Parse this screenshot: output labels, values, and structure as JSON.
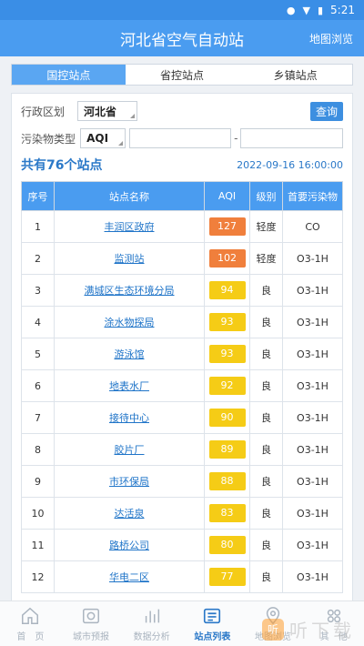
{
  "status_bar": {
    "time": "5:21"
  },
  "app_bar": {
    "title": "河北省空气自动站",
    "map_link": "地图浏览"
  },
  "tabs": [
    {
      "label": "国控站点",
      "active": true
    },
    {
      "label": "省控站点",
      "active": false
    },
    {
      "label": "乡镇站点",
      "active": false
    }
  ],
  "filters": {
    "region_label": "行政区划",
    "region_value": "河北省",
    "pollutant_label": "污染物类型",
    "pollutant_value": "AQI",
    "range_separator": "-",
    "query_label": "查询"
  },
  "summary": {
    "count_text": "共有76个站点",
    "datetime": "2022-09-16 16:00:00"
  },
  "table": {
    "headers": [
      "序号",
      "站点名称",
      "AQI",
      "级别",
      "首要污染物"
    ],
    "rows": [
      {
        "no": "1",
        "name": "丰润区政府",
        "aqi": "127",
        "level": "轻度",
        "pollutant": "CO",
        "color": "#f07f3c"
      },
      {
        "no": "2",
        "name": "监测站",
        "aqi": "102",
        "level": "轻度",
        "pollutant": "O3-1H",
        "color": "#f07f3c"
      },
      {
        "no": "3",
        "name": "满城区生态环境分局",
        "aqi": "94",
        "level": "良",
        "pollutant": "O3-1H",
        "color": "#f5cc16"
      },
      {
        "no": "4",
        "name": "涂水物探局",
        "aqi": "93",
        "level": "良",
        "pollutant": "O3-1H",
        "color": "#f5cc16"
      },
      {
        "no": "5",
        "name": "游泳馆",
        "aqi": "93",
        "level": "良",
        "pollutant": "O3-1H",
        "color": "#f5cc16"
      },
      {
        "no": "6",
        "name": "地表水厂",
        "aqi": "92",
        "level": "良",
        "pollutant": "O3-1H",
        "color": "#f5cc16"
      },
      {
        "no": "7",
        "name": "接待中心",
        "aqi": "90",
        "level": "良",
        "pollutant": "O3-1H",
        "color": "#f5cc16"
      },
      {
        "no": "8",
        "name": "胶片厂",
        "aqi": "89",
        "level": "良",
        "pollutant": "O3-1H",
        "color": "#f5cc16"
      },
      {
        "no": "9",
        "name": "市环保局",
        "aqi": "88",
        "level": "良",
        "pollutant": "O3-1H",
        "color": "#f5cc16"
      },
      {
        "no": "10",
        "name": "达活泉",
        "aqi": "83",
        "level": "良",
        "pollutant": "O3-1H",
        "color": "#f5cc16"
      },
      {
        "no": "11",
        "name": "路桥公司",
        "aqi": "80",
        "level": "良",
        "pollutant": "O3-1H",
        "color": "#f5cc16"
      },
      {
        "no": "12",
        "name": "华电二区",
        "aqi": "77",
        "level": "良",
        "pollutant": "O3-1H",
        "color": "#f5cc16"
      }
    ]
  },
  "bottom_nav": [
    {
      "label": "首　页",
      "icon": "home-icon",
      "active": false
    },
    {
      "label": "城市预报",
      "icon": "forecast-icon",
      "active": false
    },
    {
      "label": "数据分析",
      "icon": "bar-chart-icon",
      "active": false
    },
    {
      "label": "站点列表",
      "icon": "list-icon",
      "active": true
    },
    {
      "label": "地图浏览",
      "icon": "map-pin-icon",
      "active": false
    },
    {
      "label": "其　他",
      "icon": "more-icon",
      "active": false
    }
  ],
  "watermark": {
    "logo_text": "听",
    "text": "听下载"
  },
  "colors": {
    "primary": "#4a9cf0",
    "link": "#1f74c8",
    "aqi_light": "#f07f3c",
    "aqi_good": "#f5cc16"
  }
}
